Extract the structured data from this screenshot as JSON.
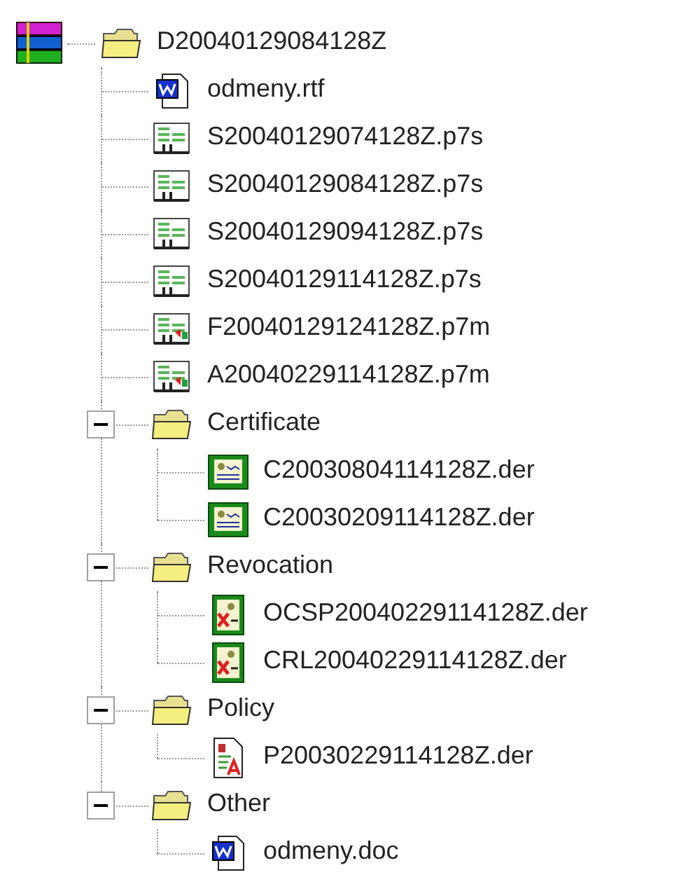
{
  "tree": {
    "label": "D20040129084128Z",
    "kind": "folder",
    "children": [
      {
        "label": "odmeny.rtf",
        "kind": "word"
      },
      {
        "label": "S20040129074128Z.p7s",
        "kind": "signed"
      },
      {
        "label": "S20040129084128Z.p7s",
        "kind": "signed"
      },
      {
        "label": "S20040129094128Z.p7s",
        "kind": "signed"
      },
      {
        "label": "S20040129114128Z.p7s",
        "kind": "signed"
      },
      {
        "label": "F20040129124128Z.p7m",
        "kind": "enveloped"
      },
      {
        "label": "A20040229114128Z.p7m",
        "kind": "enveloped"
      },
      {
        "label": "Certificate",
        "kind": "folder",
        "expanded": true,
        "children": [
          {
            "label": "C20030804114128Z.der",
            "kind": "certificate"
          },
          {
            "label": "C20030209114128Z.der",
            "kind": "certificate"
          }
        ]
      },
      {
        "label": "Revocation",
        "kind": "folder",
        "expanded": true,
        "children": [
          {
            "label": "OCSP20040229114128Z.der",
            "kind": "revoked"
          },
          {
            "label": "CRL20040229114128Z.der",
            "kind": "revoked"
          }
        ]
      },
      {
        "label": "Policy",
        "kind": "folder",
        "expanded": true,
        "children": [
          {
            "label": "P20030229114128Z.der",
            "kind": "policy"
          }
        ]
      },
      {
        "label": "Other",
        "kind": "folder",
        "expanded": true,
        "children": [
          {
            "label": "odmeny.doc",
            "kind": "word"
          }
        ]
      }
    ]
  }
}
